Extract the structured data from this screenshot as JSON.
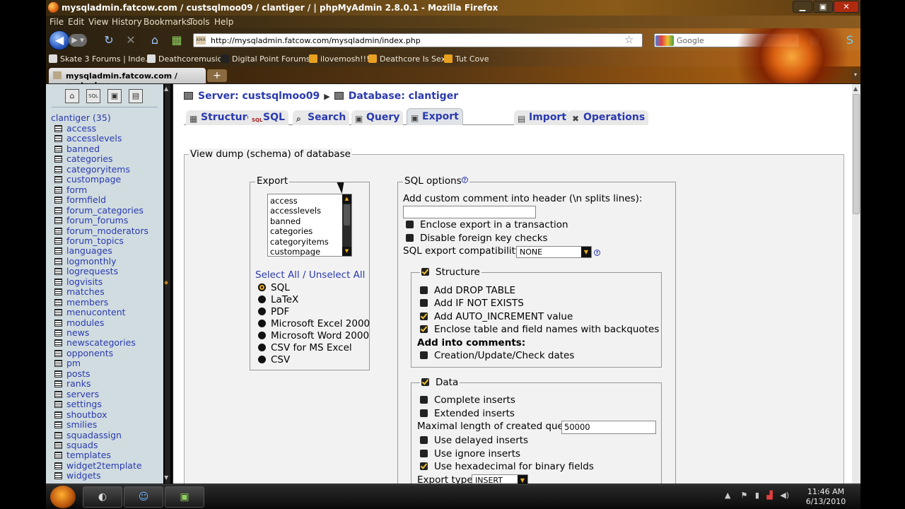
{
  "window": {
    "title": "mysqladmin.fatcow.com / custsqlmoo09 / clantiger / | phpMyAdmin 2.8.0.1 - Mozilla Firefox",
    "min": "▁",
    "max": "▣",
    "close": "✕"
  },
  "menubar": [
    "File",
    "Edit",
    "View",
    "History",
    "Bookmarks",
    "Tools",
    "Help"
  ],
  "nav": {
    "url": "http://mysqladmin.fatcow.com/mysqladmin/index.php",
    "search_placeholder": "Google",
    "url_fav": "AMA"
  },
  "bookmarks": [
    "Skate 3 Forums | Inde...",
    "Deathcoremusic",
    "Digital Point Forums",
    "ilovemosh!!!",
    "Deathcore Is Sexy",
    "Tut Cove"
  ],
  "tab": {
    "label": "mysqladmin.fatcow.com / custsqlmo...",
    "new": "+"
  },
  "sidebar": {
    "db_label": "clantiger (35)",
    "tables": [
      "access",
      "accesslevels",
      "banned",
      "categories",
      "categoryitems",
      "custompage",
      "form",
      "formfield",
      "forum_categories",
      "forum_forums",
      "forum_moderators",
      "forum_topics",
      "languages",
      "logmonthly",
      "logrequests",
      "logvisits",
      "matches",
      "members",
      "menucontent",
      "modules",
      "news",
      "newscategories",
      "opponents",
      "pm",
      "posts",
      "ranks",
      "servers",
      "settings",
      "shoutbox",
      "smilies",
      "squadassign",
      "squads",
      "templates",
      "widget2template",
      "widgets"
    ]
  },
  "breadcrumb": {
    "server": "Server: custsqlmoo09",
    "database": "Database: clantiger"
  },
  "tabs": [
    "Structure",
    "SQL",
    "Search",
    "Query",
    "Export",
    "Import",
    "Operations"
  ],
  "active_tab": "Export",
  "dump": {
    "legend": "View dump (schema) of database",
    "export": {
      "legend": "Export",
      "list": [
        "access",
        "accesslevels",
        "banned",
        "categories",
        "categoryitems",
        "custompage"
      ],
      "select_all": "Select All",
      "sep": "/",
      "unselect_all": "Unselect All",
      "formats": [
        "SQL",
        "LaTeX",
        "PDF",
        "Microsoft Excel 2000",
        "Microsoft Word 2000",
        "CSV for MS Excel",
        "CSV"
      ],
      "selected_format": "SQL"
    },
    "sql_options": {
      "legend": "SQL options",
      "help": "?",
      "comment_label": "Add custom comment into header (\\n splits lines):",
      "comment_value": "",
      "enclose_transaction": "Enclose export in a transaction",
      "disable_fk": "Disable foreign key checks",
      "compat_label": "SQL export compatibility:",
      "compat_value": "NONE",
      "structure": {
        "legend": "Structure",
        "drop_table": "Add DROP TABLE",
        "if_not_exists": "Add IF NOT EXISTS",
        "auto_increment": "Add AUTO_INCREMENT value",
        "backquotes": "Enclose table and field names with backquotes",
        "comments_heading": "Add into comments:",
        "dates": "Creation/Update/Check dates"
      },
      "data": {
        "legend": "Data",
        "complete_inserts": "Complete inserts",
        "extended_inserts": "Extended inserts",
        "max_query_label": "Maximal length of created query:",
        "max_query_value": "50000",
        "delayed": "Use delayed inserts",
        "ignore": "Use ignore inserts",
        "hex": "Use hexadecimal for binary fields",
        "export_type_label": "Export type:",
        "export_type_value": "INSERT"
      }
    }
  },
  "taskbar": {
    "time": "11:46 AM",
    "date": "6/13/2010"
  }
}
